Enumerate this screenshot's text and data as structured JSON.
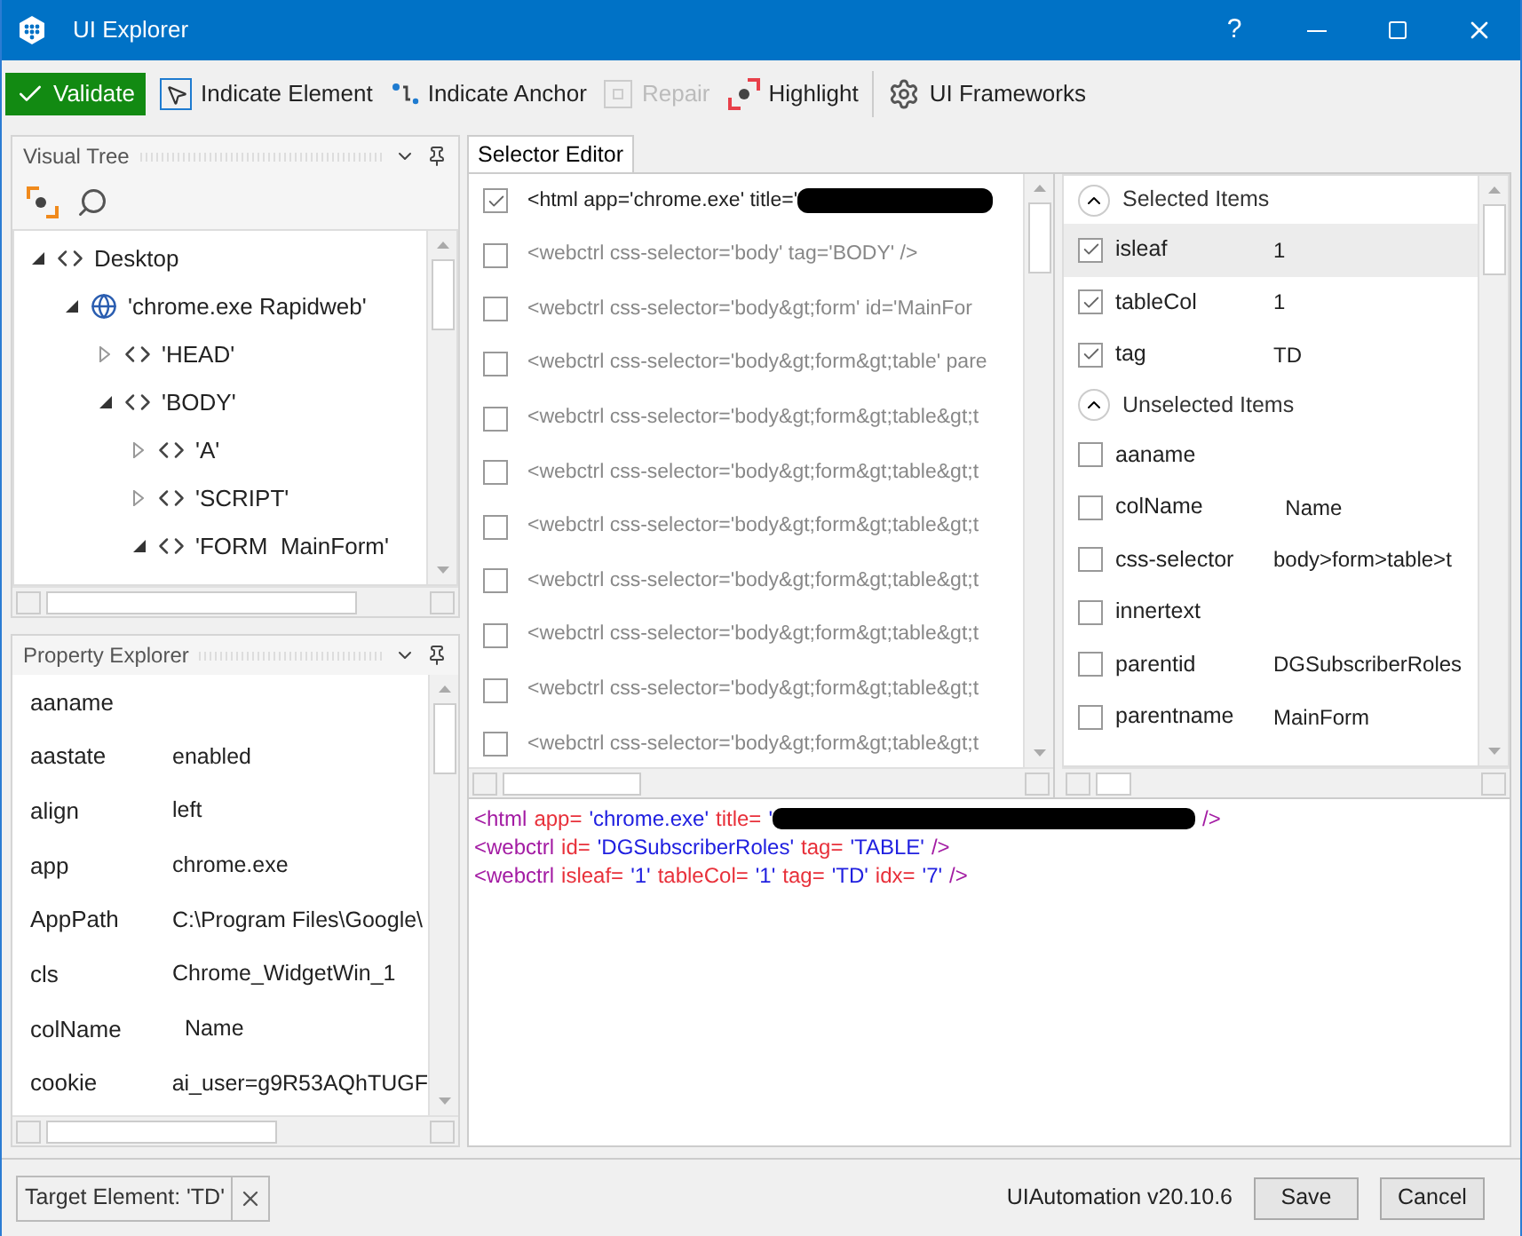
{
  "window": {
    "title": "UI Explorer",
    "controls": [
      "?"
    ]
  },
  "toolbar": [
    {
      "label": "Validate",
      "kind": "validate",
      "disabled": false
    },
    {
      "label": "Indicate Element",
      "kind": "element",
      "disabled": false
    },
    {
      "label": "Indicate Anchor",
      "kind": "anchor",
      "disabled": false
    },
    {
      "label": "Repair",
      "kind": "repair",
      "disabled": true
    },
    {
      "label": "Highlight",
      "kind": "highlight",
      "disabled": false
    },
    {
      "label": "UI Frameworks",
      "kind": "frameworks",
      "disabled": false
    }
  ],
  "visual_tree": {
    "title": "Visual Tree",
    "items": [
      {
        "label": "Desktop",
        "kind": "code",
        "expanded": true,
        "children": [
          {
            "label": "'chrome.exe Rapidweb'",
            "kind": "globe",
            "expanded": true,
            "children": [
              {
                "label": "'HEAD'",
                "kind": "code",
                "expanded": false
              },
              {
                "label": "'BODY'",
                "kind": "code",
                "expanded": true,
                "children": [
                  {
                    "label": "'A'",
                    "kind": "code",
                    "expanded": false
                  },
                  {
                    "label": "'SCRIPT'",
                    "kind": "code",
                    "expanded": false
                  },
                  {
                    "label": "'FORM  MainForm'",
                    "kind": "code",
                    "expanded": true
                  }
                ]
              }
            ]
          }
        ]
      }
    ]
  },
  "property_explorer": {
    "title": "Property Explorer",
    "rows": [
      {
        "name": "aaname",
        "value": ""
      },
      {
        "name": "aastate",
        "value": "enabled"
      },
      {
        "name": "align",
        "value": "left"
      },
      {
        "name": "app",
        "value": "chrome.exe"
      },
      {
        "name": "AppPath",
        "value": "C:\\Program Files\\Google\\"
      },
      {
        "name": "cls",
        "value": "Chrome_WidgetWin_1"
      },
      {
        "name": "colName",
        "value": "  Name"
      },
      {
        "name": "cookie",
        "value": "ai_user=g9R53AQhTUGF"
      }
    ]
  },
  "selector_editor": {
    "tab": "Selector Editor",
    "rows": [
      {
        "text": "<html app='chrome.exe' title='",
        "checked": true,
        "redacted": true
      },
      {
        "text": "<webctrl css-selector='body' tag='BODY' />",
        "checked": false,
        "redacted": false
      },
      {
        "text": "<webctrl css-selector='body&gt;form' id='MainFor",
        "checked": false,
        "redacted": false
      },
      {
        "text": "<webctrl css-selector='body&gt;form&gt;table' pare",
        "checked": false,
        "redacted": false
      },
      {
        "text": "<webctrl css-selector='body&gt;form&gt;table&gt;t",
        "checked": false,
        "redacted": false
      },
      {
        "text": "<webctrl css-selector='body&gt;form&gt;table&gt;t",
        "checked": false,
        "redacted": false
      },
      {
        "text": "<webctrl css-selector='body&gt;form&gt;table&gt;t",
        "checked": false,
        "redacted": false
      },
      {
        "text": "<webctrl css-selector='body&gt;form&gt;table&gt;t",
        "checked": false,
        "redacted": false
      },
      {
        "text": "<webctrl css-selector='body&gt;form&gt;table&gt;t",
        "checked": false,
        "redacted": false
      },
      {
        "text": "<webctrl css-selector='body&gt;form&gt;table&gt;t",
        "checked": false,
        "redacted": false
      },
      {
        "text": "<webctrl css-selector='body&gt;form&gt;table&gt;t",
        "checked": false,
        "redacted": false
      }
    ],
    "attribute_groups": [
      {
        "title": "Selected Items",
        "expanded": true,
        "items": [
          {
            "name": "isleaf",
            "value": "1",
            "checked": true,
            "selected": true
          },
          {
            "name": "tableCol",
            "value": "1",
            "checked": true,
            "selected": false
          },
          {
            "name": "tag",
            "value": "TD",
            "checked": true,
            "selected": false
          }
        ]
      },
      {
        "title": "Unselected Items",
        "expanded": true,
        "items": [
          {
            "name": "aaname",
            "value": "",
            "checked": false,
            "selected": false
          },
          {
            "name": "colName",
            "value": "  Name",
            "checked": false,
            "selected": false
          },
          {
            "name": "css-selector",
            "value": "body>form>table>t",
            "checked": false,
            "selected": false
          },
          {
            "name": "innertext",
            "value": "",
            "checked": false,
            "selected": false
          },
          {
            "name": "parentid",
            "value": "DGSubscriberRoles",
            "checked": false,
            "selected": false
          },
          {
            "name": "parentname",
            "value": "MainForm",
            "checked": false,
            "selected": false
          }
        ]
      }
    ],
    "code_lines": [
      [
        {
          "text": "<html",
          "kind": "tag"
        },
        {
          "text": "app=",
          "kind": "attr"
        },
        {
          "text": "'chrome.exe'",
          "kind": "value"
        },
        {
          "text": "title=",
          "kind": "attr"
        },
        {
          "text": "'",
          "kind": "value"
        },
        {
          "kind": "redaction"
        },
        {
          "text": "/>",
          "kind": "tag"
        }
      ],
      [
        {
          "text": "<webctrl",
          "kind": "tag"
        },
        {
          "text": "id=",
          "kind": "attr"
        },
        {
          "text": "'DGSubscriberRoles'",
          "kind": "value"
        },
        {
          "text": "tag=",
          "kind": "attr"
        },
        {
          "text": "'TABLE'",
          "kind": "value"
        },
        {
          "text": "/>",
          "kind": "tag"
        }
      ],
      [
        {
          "text": "<webctrl",
          "kind": "tag"
        },
        {
          "text": "isleaf=",
          "kind": "attr"
        },
        {
          "text": "'1'",
          "kind": "value"
        },
        {
          "text": "tableCol=",
          "kind": "attr"
        },
        {
          "text": "'1'",
          "kind": "value"
        },
        {
          "text": "tag=",
          "kind": "attr"
        },
        {
          "text": "'TD'",
          "kind": "value"
        },
        {
          "text": "idx=",
          "kind": "attr"
        },
        {
          "text": "'7'",
          "kind": "value"
        },
        {
          "text": "/>",
          "kind": "tag"
        }
      ]
    ]
  },
  "status": {
    "target": "Target Element: 'TD'",
    "version": "UIAutomation v20.10.6",
    "buttons": [
      "Save",
      "Cancel"
    ]
  }
}
